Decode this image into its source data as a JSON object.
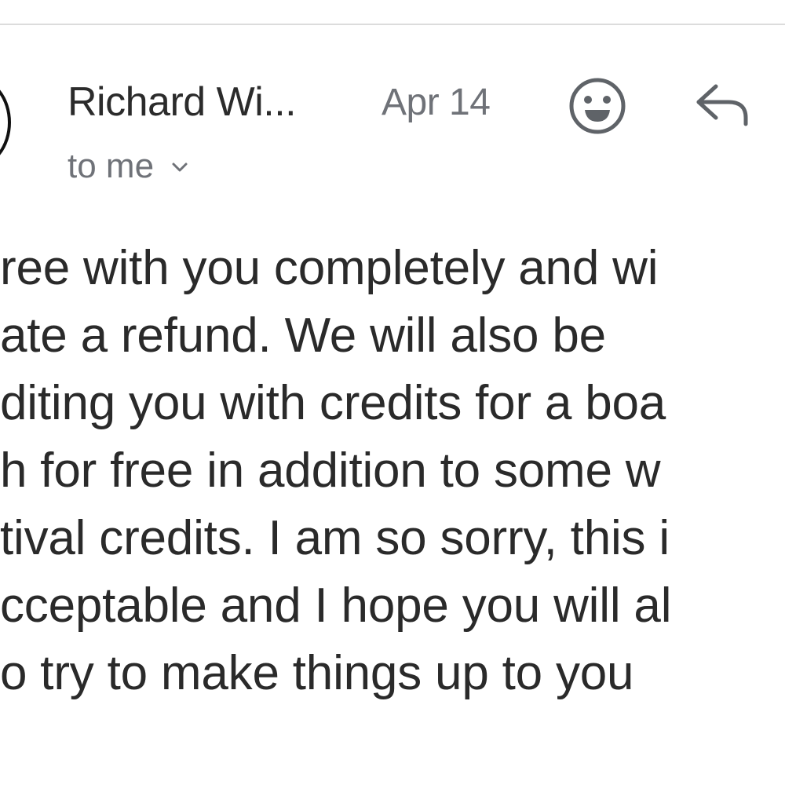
{
  "email_header": {
    "sender_name": "Richard Wi...",
    "date": "Apr 14",
    "recipients_label": "to me",
    "icons": {
      "react": "smiley-face-icon",
      "reply": "reply-arrow-icon",
      "expand": "chevron-down-icon"
    }
  },
  "message": {
    "lines": [
      "ree with you completely and wi",
      "ate a refund. We will also be",
      "diting you with credits for a boa",
      "h for free in addition to some w",
      "tival credits. I am so sorry, this i",
      "cceptable and I hope you will al",
      "o try to make things up to you"
    ]
  },
  "colors": {
    "body_text": "#2a2a2a",
    "secondary_text": "#6f7278",
    "icon": "#5f6368",
    "divider": "#dcdcdc"
  }
}
